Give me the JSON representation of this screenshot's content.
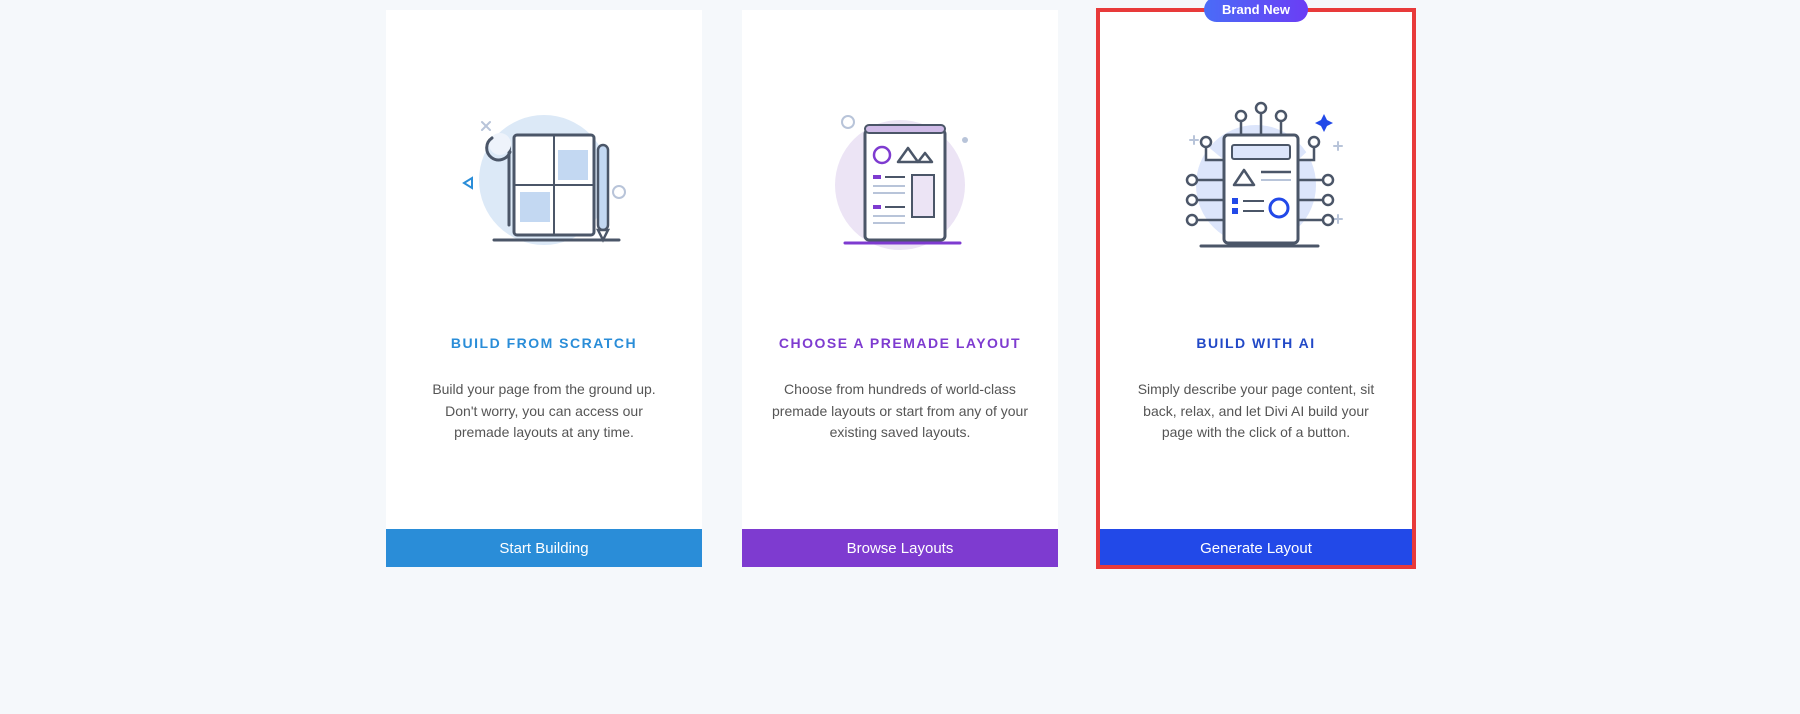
{
  "cards": [
    {
      "title": "BUILD FROM SCRATCH",
      "description": "Build your page from the ground up. Don't worry, you can access our premade layouts at any time.",
      "button_label": "Start Building"
    },
    {
      "title": "CHOOSE A PREMADE LAYOUT",
      "description": "Choose from hundreds of world-class premade layouts or start from any of your existing saved layouts.",
      "button_label": "Browse Layouts"
    },
    {
      "badge": "Brand New",
      "title": "BUILD WITH AI",
      "description": "Simply describe your page content, sit back, relax, and let Divi AI build your page with the click of a button.",
      "button_label": "Generate Layout"
    }
  ]
}
